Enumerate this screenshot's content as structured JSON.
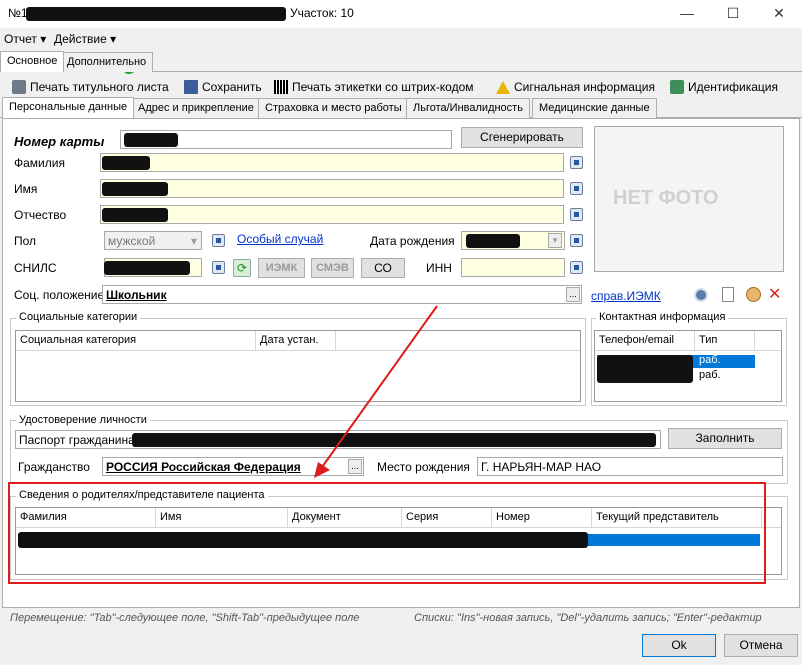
{
  "window": {
    "title_prefix": "№1",
    "title_suffix": "Участок: 10",
    "minimize": "—",
    "maximize": "☐",
    "close": "✕"
  },
  "menu": {
    "report": "Отчет",
    "action": "Действие"
  },
  "top_tabs": [
    "Основное",
    "Дополнительно"
  ],
  "toolbar": {
    "print_title": "Печать титульного листа",
    "save": "Сохранить",
    "print_barcode": "Печать этикетки со штрих-кодом",
    "signal_info": "Сигнальная информация",
    "identification": "Идентификация"
  },
  "sub_tabs": [
    "Персональные данные",
    "Адрес и прикрепление",
    "Страховка и место работы",
    "Льгота/Инвалидность",
    "Медицинские данные"
  ],
  "form": {
    "card_number_label": "Номер карты",
    "generate_button": "Сгенерировать",
    "no_photo": "НЕТ ФОТО",
    "surname_label": "Фамилия",
    "name_label": "Имя",
    "patronymic_label": "Отчество",
    "gender_label": "Пол",
    "gender_value": "мужской",
    "special_case_link": "Особый случай",
    "birth_date_label": "Дата рождения",
    "snils_label": "СНИЛС",
    "iemk_button": "ИЭМК",
    "smev_button": "СМЭВ",
    "co_button": "СО",
    "inn_label": "ИНН",
    "social_status_label": "Соц. положение",
    "social_status_value": "Школьник",
    "ref_iemk_link": "справ.ИЭМК"
  },
  "social_categories": {
    "title": "Социальные категории",
    "columns": [
      "Социальная категория",
      "Дата устан."
    ]
  },
  "contact_info": {
    "title": "Контактная информация",
    "columns": [
      "Телефон/email",
      "Тип"
    ],
    "rows": [
      {
        "type": "раб."
      },
      {
        "type": "раб."
      }
    ]
  },
  "identity": {
    "title": "Удостоверение личности",
    "doc_value": "Паспорт гражданина Р",
    "fill_button": "Заполнить",
    "citizenship_label": "Гражданство",
    "citizenship_value": "РОССИЯ Российская Федерация",
    "birthplace_label": "Место рождения",
    "birthplace_value": "Г. НАРЬЯН-МАР НАО"
  },
  "parents": {
    "title": "Сведения о родителях/представителе пациента",
    "columns": [
      "Фамилия",
      "Имя",
      "Документ",
      "Серия",
      "Номер",
      "Текущий представитель"
    ]
  },
  "hints": {
    "left": "Перемещение: \"Tab\"-следующее поле, \"Shift-Tab\"-предыдущее поле",
    "right": "Списки: \"Ins\"-новая запись, \"Del\"-удалить запись; \"Enter\"-редактир"
  },
  "buttons": {
    "ok": "Ok",
    "cancel": "Отмена"
  },
  "colors": {
    "selection": "#0078d7",
    "highlight_frame": "#e01b1b",
    "yellow_field": "#ffffe1"
  }
}
